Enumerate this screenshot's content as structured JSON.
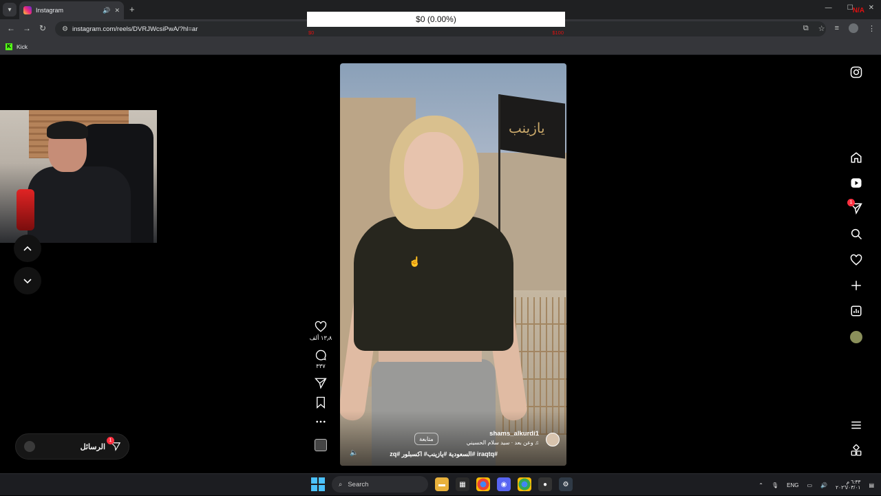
{
  "browser": {
    "tab_title": "Instagram",
    "url": "instagram.com/reels/DVRJWcsiPwA/?hl=ar",
    "bookmark_label": "Kick"
  },
  "overlay": {
    "amount_text": "$0 (0.00%)",
    "top_text": "",
    "left_text": "$0",
    "center_text": "",
    "right_text": "$100",
    "corner_text": "N/A"
  },
  "reel": {
    "username": "shams_alkurdi1",
    "audio": "وعن بعد · سيد سلام الحسيني",
    "follow_label": "متابعة",
    "hashtags": "#iraqtq #السعودية #يازينب# اكسبلور #zq",
    "likes": "١٣٫٨ ألف",
    "comments": "٣٣٧",
    "flag_text": "يازينب"
  },
  "messages": {
    "label": "الرسائل",
    "badge": "1"
  },
  "sidebar": {
    "notification_badge": "1"
  },
  "taskbar": {
    "search_placeholder": "Search",
    "language": "ENG",
    "time": "٦:٣٣ م",
    "date": "٢٠٢٦/٠٣/٠١"
  },
  "colors": {
    "instagram_red": "#ff3040",
    "overlay_red": "#e01010",
    "kick_green": "#53fc18"
  }
}
